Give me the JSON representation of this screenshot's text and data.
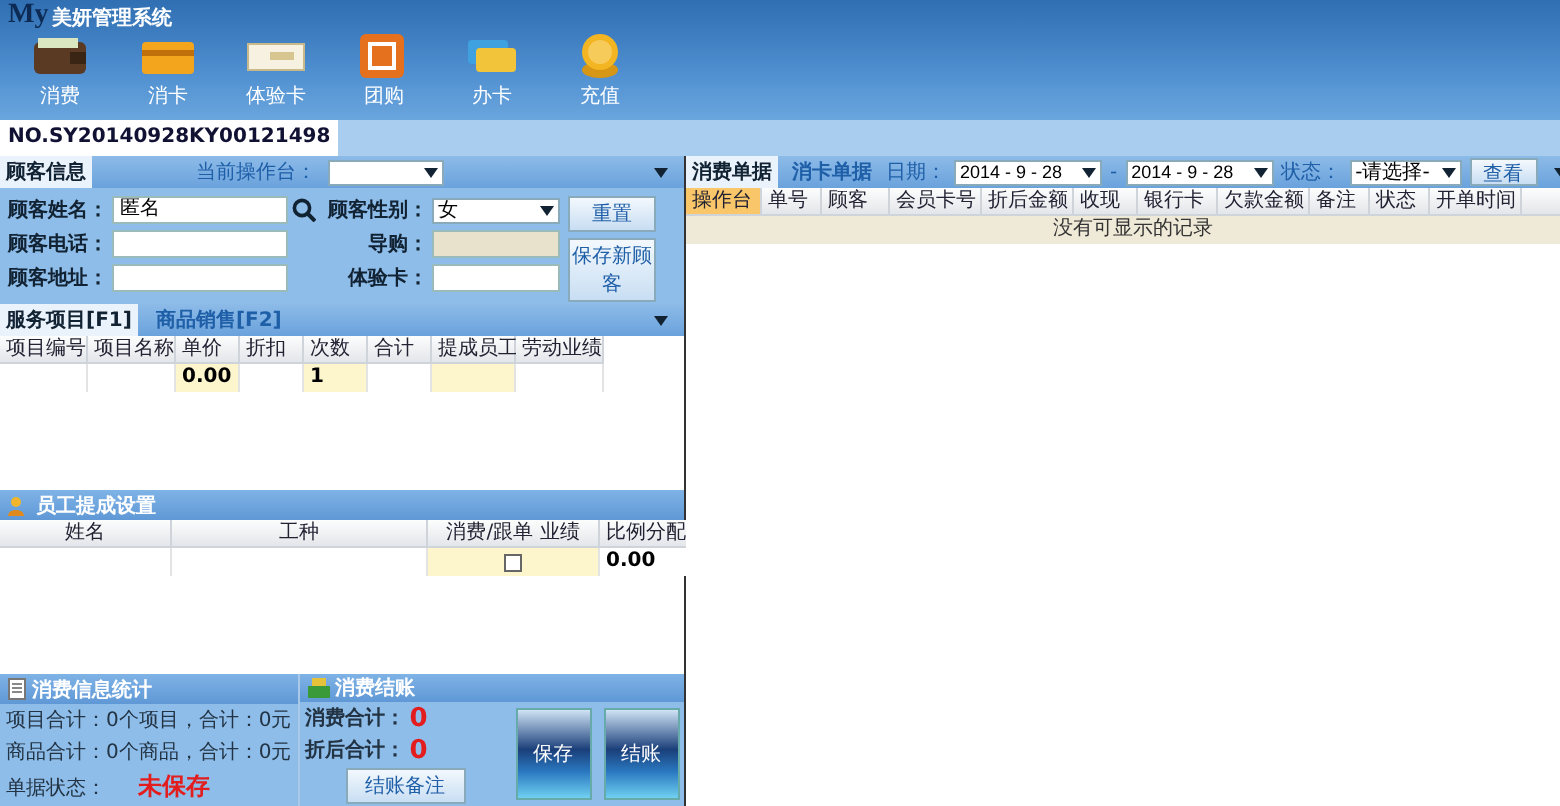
{
  "app": {
    "logo": "My",
    "title": "美妍管理系统"
  },
  "toolbar": [
    {
      "label": "消费",
      "kind": "wallet"
    },
    {
      "label": "消卡",
      "kind": "card"
    },
    {
      "label": "体验卡",
      "kind": "ticket"
    },
    {
      "label": "团购",
      "kind": "group"
    },
    {
      "label": "办卡",
      "kind": "cards"
    },
    {
      "label": "充值",
      "kind": "coins"
    }
  ],
  "order_no": "NO.SY20140928KY00121498",
  "customer": {
    "tab": "顾客信息",
    "operator_label": "当前操作台：",
    "fields": [
      {
        "label": "顾客姓名：",
        "value": "匿名",
        "kind": "search"
      },
      {
        "label": "顾客电话：",
        "kind": "text"
      },
      {
        "label": "顾客地址：",
        "kind": "text"
      }
    ],
    "fields_right": [
      {
        "label": "顾客性别：",
        "value": "女",
        "kind": "select"
      },
      {
        "label": "导购：",
        "kind": "disabled"
      },
      {
        "label": "体验卡：",
        "kind": "text"
      }
    ],
    "buttons": [
      "重置",
      "保存新顾客"
    ]
  },
  "item_tabs": [
    {
      "label": "服务项目[F1]",
      "selected": true
    },
    {
      "label": "商品销售[F2]",
      "selected": false
    }
  ],
  "items_table": {
    "columns": [
      {
        "label": "项目编号",
        "highlight": false
      },
      {
        "label": "项目名称",
        "highlight": false
      },
      {
        "label": "单价",
        "highlight": true
      },
      {
        "label": "折扣",
        "highlight": false
      },
      {
        "label": "次数",
        "highlight": true
      },
      {
        "label": "合计",
        "highlight": false
      },
      {
        "label": "提成员工",
        "highlight": true
      },
      {
        "label": "劳动业绩",
        "highlight": false
      }
    ],
    "rows": [
      [
        "",
        "",
        "0.00",
        "",
        "1",
        "",
        "",
        ""
      ]
    ]
  },
  "staff": {
    "title": "员工提成设置",
    "columns": [
      "姓名",
      "工种",
      "消费/跟单 业绩",
      "比例分配"
    ],
    "rows": [
      {
        "name": "",
        "type": "",
        "checked": false,
        "ratio": "0.00"
      }
    ]
  },
  "stats": {
    "title": "消费信息统计",
    "lines": [
      "项目合计：0个项目，合计：0元",
      "商品合计：0个商品，合计：0元"
    ],
    "status_label": "单据状态：",
    "status": "未保存"
  },
  "checkout": {
    "title": "消费结账",
    "total_label": "消费合计：",
    "total": "0",
    "discounted_label": "折后合计：",
    "discounted": "0",
    "note_button": "结账备注",
    "buttons": [
      "保存",
      "结账"
    ]
  },
  "receipts": {
    "tabs": [
      {
        "label": "消费单据",
        "selected": true
      },
      {
        "label": "消卡单据",
        "selected": false
      }
    ],
    "date_label": "日期：",
    "date_from": "2014 - 9 - 28",
    "dash": "-",
    "date_to": "2014 - 9 - 28",
    "status_label": "状态：",
    "status_value": "-请选择-",
    "view_button": "查看",
    "columns": [
      {
        "label": "操作台",
        "selected": true
      },
      {
        "label": "单号",
        "selected": false
      },
      {
        "label": "顾客",
        "selected": false
      },
      {
        "label": "会员卡号",
        "selected": false
      },
      {
        "label": "折后金额",
        "selected": false
      },
      {
        "label": "收现",
        "selected": false
      },
      {
        "label": "银行卡",
        "selected": false
      },
      {
        "label": "欠款金额",
        "selected": false
      },
      {
        "label": "备注",
        "selected": false
      },
      {
        "label": "状态",
        "selected": false
      },
      {
        "label": "开单时间",
        "selected": false
      }
    ],
    "empty": "没有可显示的记录"
  }
}
